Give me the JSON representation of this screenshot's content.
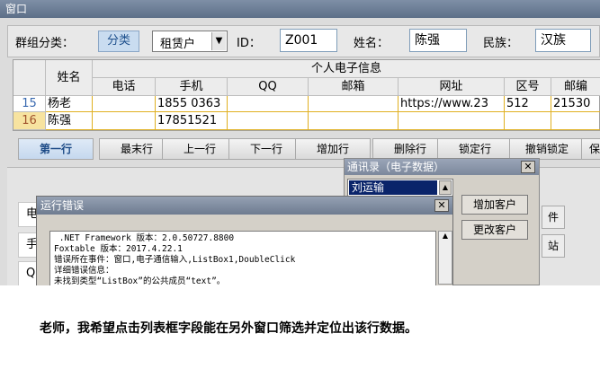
{
  "window": {
    "title": "窗口"
  },
  "filter": {
    "group_label": "群组分类：",
    "category_button": "分类",
    "combo_value": "租赁户",
    "combo_arrow": "▼",
    "id_label": "ID：",
    "id_value": "Z001",
    "name_label": "姓名：",
    "name_value": "陈强",
    "ethnic_label": "民族：",
    "ethnic_value": "汉族"
  },
  "grid": {
    "header_name": "姓名",
    "header_group": "个人电子信息",
    "columns": [
      "电话",
      "手机",
      "QQ",
      "邮箱",
      "网址",
      "区号",
      "邮编"
    ],
    "rows": [
      {
        "num": "15",
        "name": "杨老",
        "phone": "",
        "mobile": "1855 0363",
        "qq": "",
        "email": "",
        "url": "https://www.23",
        "area": "512",
        "zip": "21530"
      },
      {
        "num": "16",
        "name": "陈强",
        "phone": "",
        "mobile": "17851521",
        "qq": "",
        "email": "",
        "url": "",
        "area": "",
        "zip": ""
      }
    ]
  },
  "nav": {
    "first": "第一行",
    "last": "最末行",
    "prev": "上一行",
    "next": "下一行",
    "add": "增加行",
    "delete": "删除行",
    "lock": "锁定行",
    "unlock": "撤销锁定",
    "more": "保"
  },
  "lower": {
    "label1": "电",
    "label2": "手",
    "label3": "Q",
    "btn_right1": "件",
    "btn_right2": "站"
  },
  "contacts_dialog": {
    "title": "通讯录（电子数据）",
    "close": "✕",
    "selected_item": "刘运输",
    "scroll_arrow": "▲",
    "add_button": "增加客户",
    "edit_button": "更改客户"
  },
  "error_dialog": {
    "title": "运行错误",
    "close": "✕",
    "text": " .NET Framework 版本：2.0.50727.8800\nFoxtable 版本：2017.4.22.1\n错误所在事件：窗口,电子通信输入,ListBox1,DoubleClick\n详细错误信息：\n未找到类型“ListBox”的公共成员“text”。",
    "scroll_arrow": "▲"
  },
  "question": "老师，我希望点击列表框字段能在另外窗口筛选并定位出该行数据。"
}
